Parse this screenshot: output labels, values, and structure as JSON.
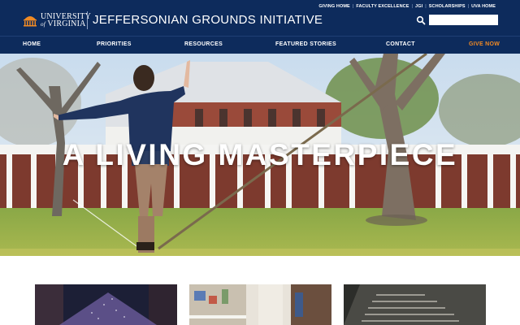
{
  "header": {
    "university_line1": "UNIVERSITY",
    "university_line2": "VIRGINIA",
    "university_of": "of",
    "site_title": "JEFFERSONIAN GROUNDS INITIATIVE",
    "logo_icon": "rotunda-icon"
  },
  "utility_links": [
    "GIVING HOME",
    "FACULTY EXCELLENCE",
    "JGI",
    "SCHOLARSHIPS",
    "UVA HOME"
  ],
  "search": {
    "placeholder": "",
    "icon": "search-icon"
  },
  "nav": {
    "items": [
      "HOME",
      "PRIORITIES",
      "RESOURCES",
      "FEATURED STORIES",
      "CONTACT"
    ],
    "give_label": "GIVE NOW"
  },
  "hero": {
    "title": "A LIVING MASTERPIECE"
  },
  "colors": {
    "header_bg": "#0d2b5c",
    "accent_orange": "#f08a24",
    "text_white": "#ffffff"
  }
}
